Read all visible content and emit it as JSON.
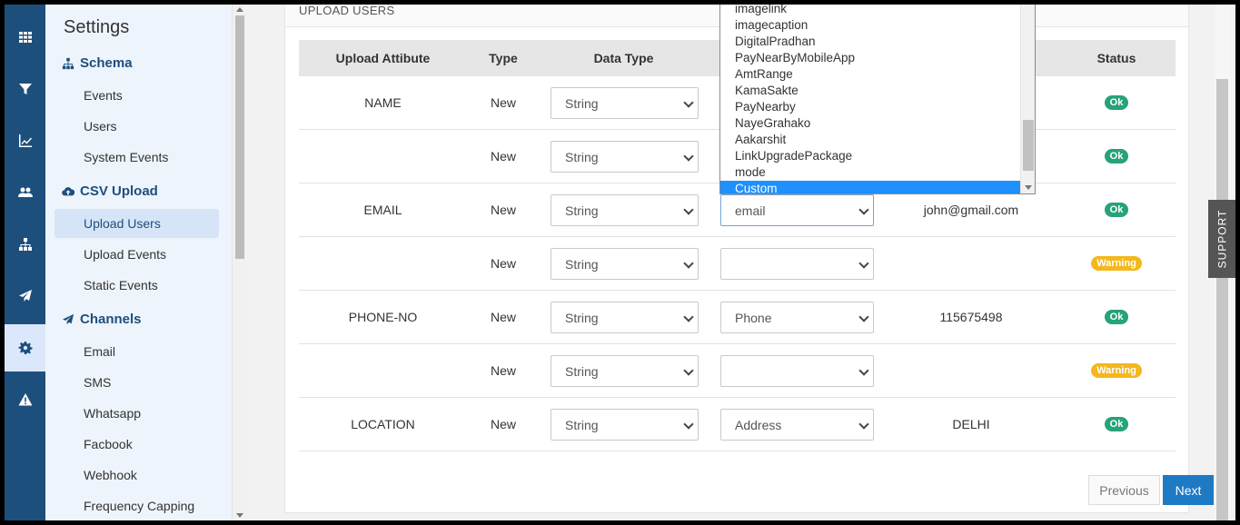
{
  "rail": {
    "items": [
      {
        "icon": "grid-icon"
      },
      {
        "icon": "filter-icon"
      },
      {
        "icon": "chart-line-icon"
      },
      {
        "icon": "users-icon"
      },
      {
        "icon": "sitemap-icon"
      },
      {
        "icon": "paper-plane-icon"
      },
      {
        "icon": "gear-icon",
        "active": true
      },
      {
        "icon": "warning-icon"
      }
    ]
  },
  "sidebar": {
    "title": "Settings",
    "sections": {
      "schema": "Schema",
      "csv_upload": "CSV Upload",
      "channels": "Channels"
    },
    "items": {
      "events": "Events",
      "users": "Users",
      "system_events": "System Events",
      "upload_users": "Upload Users",
      "upload_events": "Upload Events",
      "static_events": "Static Events",
      "email": "Email",
      "sms": "SMS",
      "whatsapp": "Whatsapp",
      "facbook": "Facbook",
      "webhook": "Webhook",
      "frequency_capping": "Frequency Capping"
    }
  },
  "main": {
    "card_title": "UPLOAD USERS",
    "headers": {
      "upload_attribute": "Upload Attibute",
      "type": "Type",
      "data_type": "Data Type",
      "status": "Status"
    },
    "rows": [
      {
        "attribute": "NAME",
        "type": "New",
        "data_type": "String",
        "mapping": "",
        "sample": "",
        "status": "Ok"
      },
      {
        "attribute": "",
        "type": "New",
        "data_type": "String",
        "mapping": "",
        "sample": "",
        "status": "Ok"
      },
      {
        "attribute": "EMAIL",
        "type": "New",
        "data_type": "String",
        "mapping": "email",
        "sample": "john@gmail.com",
        "status": "Ok"
      },
      {
        "attribute": "",
        "type": "New",
        "data_type": "String",
        "mapping": "",
        "sample": "",
        "status": "Warning"
      },
      {
        "attribute": "PHONE-NO",
        "type": "New",
        "data_type": "String",
        "mapping": "Phone",
        "sample": "115675498",
        "status": "Ok"
      },
      {
        "attribute": "",
        "type": "New",
        "data_type": "String",
        "mapping": "",
        "sample": "",
        "status": "Warning"
      },
      {
        "attribute": "LOCATION",
        "type": "New",
        "data_type": "String",
        "mapping": "Address",
        "sample": "DELHI",
        "status": "Ok"
      }
    ],
    "pagination": {
      "previous": "Previous",
      "next": "Next"
    },
    "support": "SUPPORT"
  },
  "dropdown": {
    "options": [
      "imagelink",
      "imagecaption",
      "DigitalPradhan",
      "PayNearByMobileApp",
      "AmtRange",
      "KamaSakte",
      "PayNearby",
      "NayeGrahako",
      "Aakarshit",
      "LinkUpgradePackage",
      "mode",
      "Custom"
    ],
    "selected": "Custom"
  },
  "colors": {
    "rail": "#1d4f7d",
    "ok": "#27a27a",
    "warning": "#f4b81d",
    "primary": "#1f7ac4",
    "highlight": "#1e90ff"
  }
}
